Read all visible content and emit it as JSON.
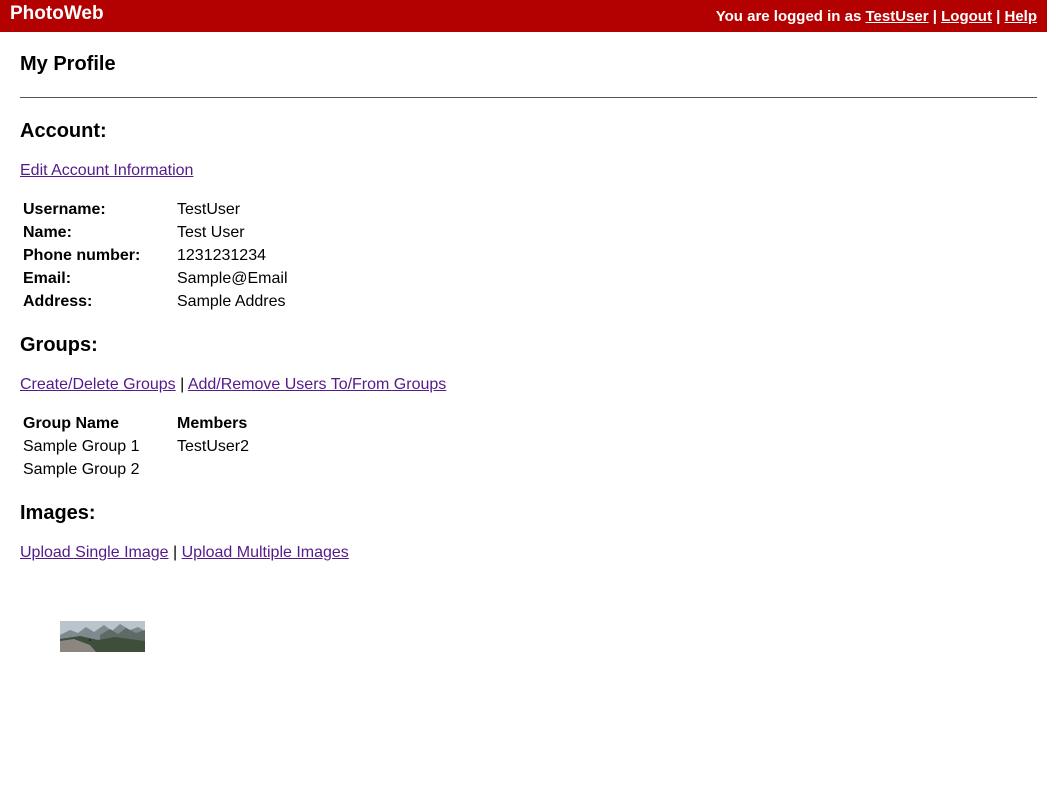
{
  "header": {
    "brand": "PhotoWeb",
    "logged_in_prefix": "You are logged in as",
    "username_link": "TestUser",
    "separator": "|",
    "logout_label": "Logout",
    "help_label": "Help",
    "bar_color": "#b30000"
  },
  "page": {
    "title": "My Profile"
  },
  "account": {
    "heading": "Account:",
    "edit_link": "Edit Account Information",
    "fields": [
      {
        "label": "Username:",
        "value": "TestUser"
      },
      {
        "label": "Name:",
        "value": "Test User"
      },
      {
        "label": "Phone number:",
        "value": "1231231234"
      },
      {
        "label": "Email:",
        "value": "Sample@Email"
      },
      {
        "label": "Address:",
        "value": "Sample Addres"
      }
    ]
  },
  "groups": {
    "heading": "Groups:",
    "create_delete_link": "Create/Delete Groups",
    "add_remove_link": "Add/Remove Users To/From Groups",
    "separator": "|",
    "columns": [
      "Group Name",
      "Members"
    ],
    "rows": [
      {
        "name": "Sample Group 1",
        "members": "TestUser2"
      },
      {
        "name": "Sample Group 2",
        "members": ""
      }
    ]
  },
  "images": {
    "heading": "Images:",
    "upload_single_link": "Upload Single Image",
    "upload_multiple_link": "Upload Multiple Images",
    "separator": "|",
    "thumbnail": "mountain-landscape-thumbnail"
  },
  "link_color": "#551a8b"
}
